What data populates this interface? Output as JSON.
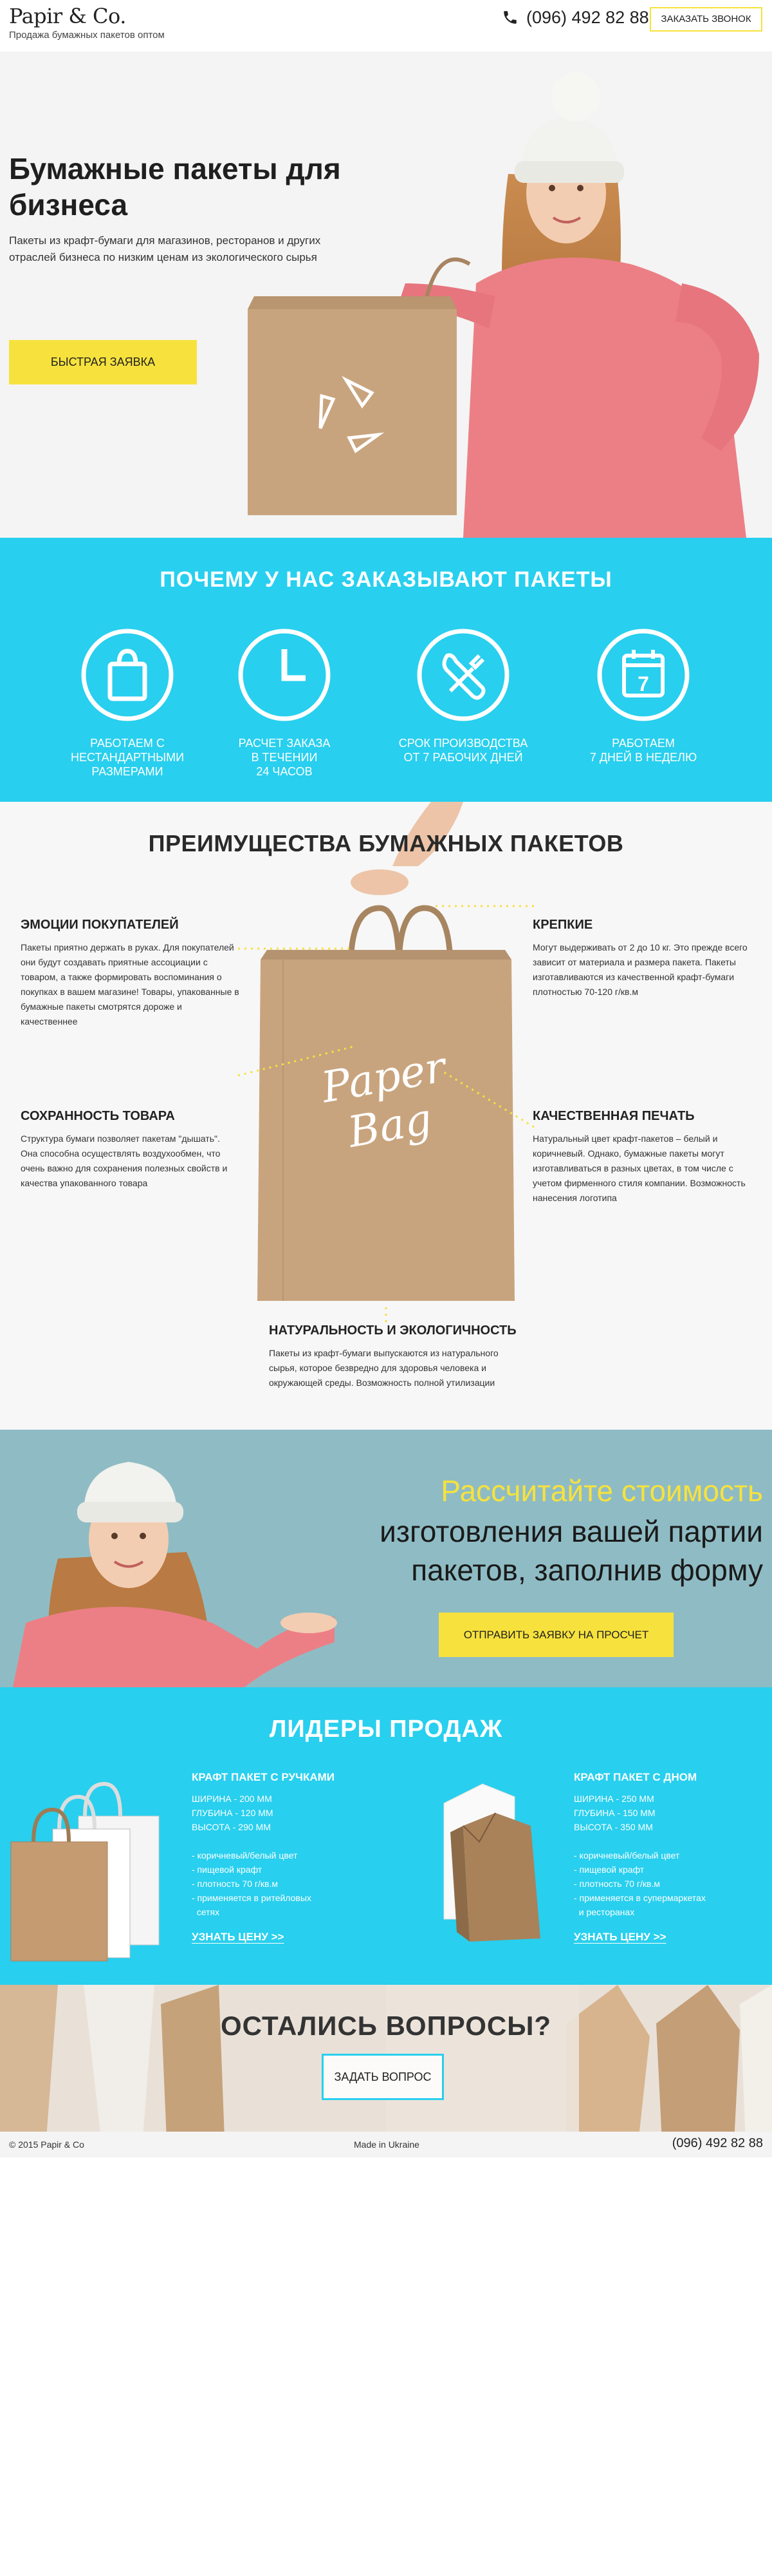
{
  "header": {
    "logo": "Papir & Co.",
    "tagline": "Продажа бумажных пакетов оптом",
    "phone": "(096) 492 82 88",
    "callback": "Заказать звонок"
  },
  "hero": {
    "title": "Бумажные пакеты для бизнеса",
    "text": "Пакеты из крафт-бумаги для магазинов, ресторанов и других отраслей бизнеса по низким ценам из экологического сырья",
    "button": "Быстрая заявка"
  },
  "why": {
    "title": "ПОЧЕМУ У НАС ЗАКАЗЫВАЮТ ПАКЕТЫ",
    "items": [
      {
        "icon": "bag-icon",
        "label": "Работаем с\nнестандартными\nразмерами"
      },
      {
        "icon": "clock-icon",
        "label": "Расчет заказа\nв течении\n24 часов"
      },
      {
        "icon": "wrench-icon",
        "label": "Срок производства\nот 7 рабочих дней"
      },
      {
        "icon": "calendar-icon",
        "label": "Работаем\n7 дней в неделю",
        "calendar_day": "7"
      }
    ]
  },
  "advantages": {
    "title": "ПРЕИМУЩЕСТВА БУМАЖНЫХ ПАКЕТОВ",
    "bag_lettering": "Paper Bag",
    "items": [
      {
        "title": "Эмоции покупателей",
        "text": "Пакеты приятно держать в руках. Для покупателей они будут создавать приятные ассоциации с товаром, а также формировать воспоминания о покупках в вашем магазине! Товары, упакованные в бумажные пакеты смотрятся дороже и качественнее"
      },
      {
        "title": "Крепкие",
        "text": "Могут выдерживать от 2 до 10 кг. Это прежде всего зависит от материала и размера пакета. Пакеты изготавливаются из качественной крафт-бумаги плотностью 70-120 г/кв.м"
      },
      {
        "title": "Сохранность товара",
        "text": "Структура бумаги позволяет пакетам \"дышать\". Она способна осуществлять воздухообмен, что очень важно для сохранения полезных свойств и качества упакованного товара"
      },
      {
        "title": "Качественная печать",
        "text": "Натуральный цвет крафт-пакетов – белый и коричневый. Однако, бумажные пакеты могут изготавливаться в разных цветах, в том числе с учетом фирменного стиля компании. Возможность нанесения логотипа"
      },
      {
        "title": "Натуральность и экологичность",
        "text": "Пакеты из крафт-бумаги выпускаются из натурального сырья, которое безвредно для здоровья человека и окружающей среды. Возможность полной утилизации"
      }
    ]
  },
  "calc": {
    "line1": "Рассчитайте стоимость",
    "line2": "изготовления вашей партии\nпакетов, заполнив форму",
    "button": "Отправить заявку на просчет"
  },
  "leaders": {
    "title": "ЛИДЕРЫ ПРОДАЖ",
    "products": [
      {
        "title": "Крафт пакет с ручками",
        "dims": [
          "Ширина - 200 мм",
          "Глубина - 120 мм",
          "Высота - 290 мм"
        ],
        "features": [
          "- коричневый/белый цвет",
          "- пищевой крафт",
          "- плотность 70 г/кв.м",
          "- применяется в ритейловых",
          "  сетях"
        ],
        "link": "Узнать цену >>"
      },
      {
        "title": "Крафт пакет с дном",
        "dims": [
          "Ширина - 250 мм",
          "Глубина - 150 мм",
          "Высота - 350 мм"
        ],
        "features": [
          "- коричневый/белый цвет",
          "- пищевой крафт",
          "- плотность 70 г/кв.м",
          "- применяется в супермаркетах",
          "  и ресторанах"
        ],
        "link": "Узнать цену >>"
      }
    ]
  },
  "questions": {
    "title": "ОСТАЛИСЬ ВОПРОСЫ?",
    "button": "Задать вопрос"
  },
  "footer": {
    "copyright": "© 2015 Papir & Co",
    "made": "Made in Ukraine",
    "phone": "(096) 492 82 88"
  },
  "colors": {
    "accent_yellow": "#f7e23d",
    "accent_cyan": "#28cfee",
    "kraft": "#c8a47e"
  }
}
